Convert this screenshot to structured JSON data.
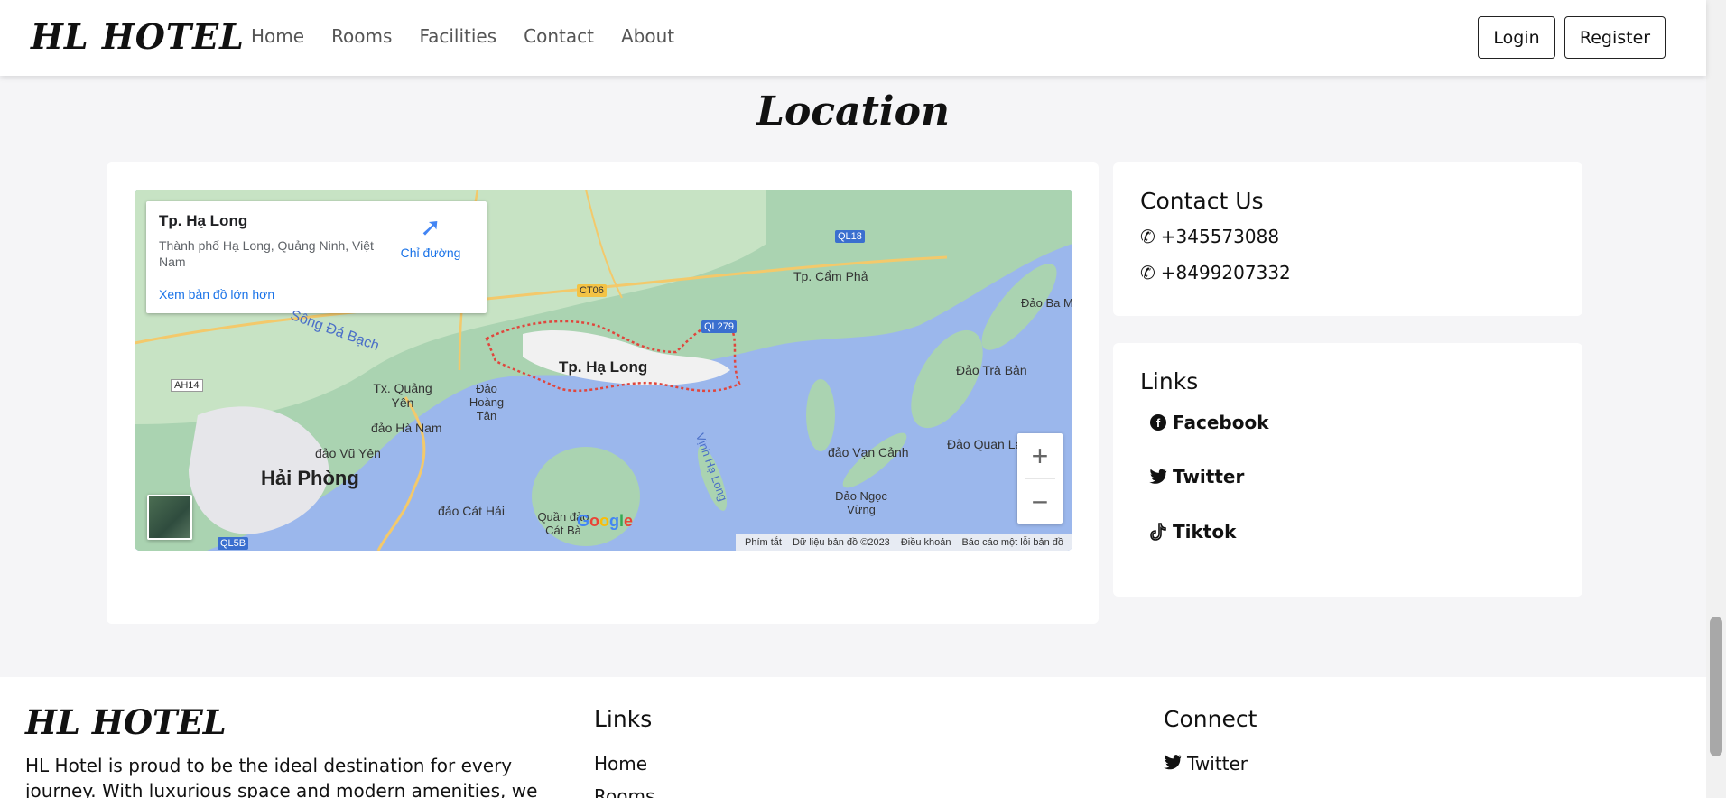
{
  "navbar": {
    "brand": "HL HOTEL",
    "links": [
      "Home",
      "Rooms",
      "Facilities",
      "Contact",
      "About"
    ],
    "login_label": "Login",
    "register_label": "Register"
  },
  "section": {
    "title": "Location"
  },
  "map": {
    "place_title": "Tp. Hạ Long",
    "place_address": "Thành phố Hạ Long, Quảng Ninh, Việt Nam",
    "directions_label": "Chỉ đường",
    "larger_map_link": "Xem bản đồ lớn hơn",
    "labels": {
      "ha_long": "Tp. Hạ Long",
      "cam_pha": "Tp. Cẩm Phả",
      "hai_phong": "Hải Phòng",
      "quang_yen": "Tx. Quảng Yên",
      "song_da_bach": "Sông Đá Bạch",
      "dao_hoang_tan": "Đảo Hoàng Tân",
      "dao_ha_nam": "đảo Hà Nam",
      "dao_vu_yen": "đảo Vũ Yên",
      "dao_cat_hai": "đảo Cát Hải",
      "quan_dao_cat_ba": "Quần đảo Cát Bà",
      "vinh_ha_long": "Vịnh Hạ Long",
      "dao_van_canh": "đảo Vạn Cảnh",
      "dao_ngoc_vung": "Đảo Ngọc Vừng",
      "dao_tra_ban": "Đảo Trà Bản",
      "dao_quan_lan": "Đảo Quan Lạn",
      "dao_ba_mun": "Đảo Ba M",
      "road_ql18": "QL18",
      "road_ct06": "CT06",
      "road_ql279": "QL279",
      "road_ah14": "AH14",
      "road_ql5b": "QL5B"
    },
    "zoom_in": "+",
    "zoom_out": "−",
    "google": "Google",
    "attribution": [
      "Phím tắt",
      "Dữ liệu bản đồ ©2023",
      "Điều khoản",
      "Báo cáo một lỗi bản đồ"
    ]
  },
  "contact": {
    "title": "Contact Us",
    "phones": [
      "+345573088",
      "+8499207332"
    ]
  },
  "links_card": {
    "title": "Links",
    "items": [
      "Facebook",
      "Twitter",
      "Tiktok"
    ]
  },
  "footer": {
    "brand": "HL HOTEL",
    "description": "HL Hotel is proud to be the ideal destination for every journey. With luxurious space and modern amenities, we",
    "links_heading": "Links",
    "links": [
      "Home",
      "Rooms"
    ],
    "connect_heading": "Connect",
    "connect": [
      "Twitter"
    ]
  }
}
